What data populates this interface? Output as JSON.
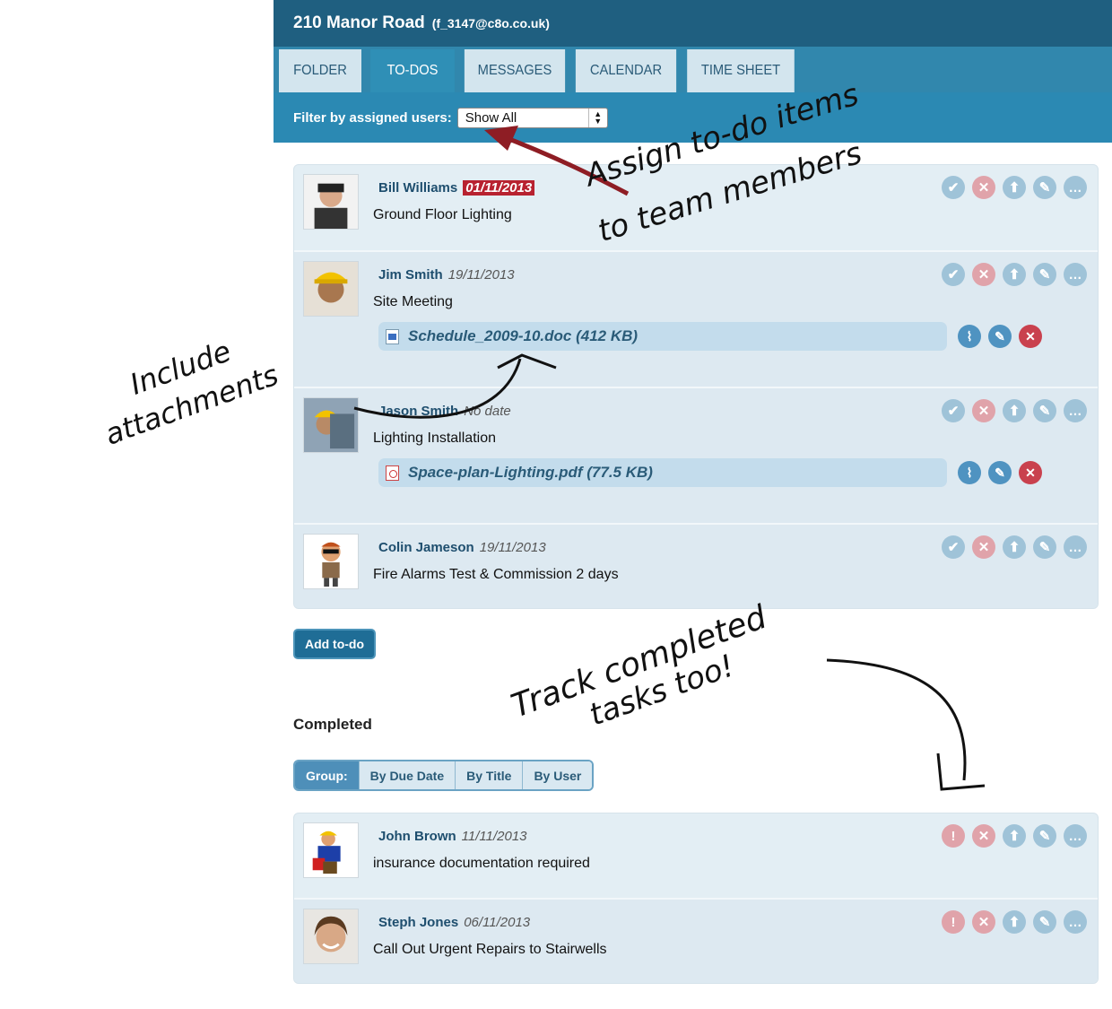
{
  "header": {
    "title": "210 Manor Road",
    "email": "(f_3147@c8o.co.uk)"
  },
  "tabs": [
    {
      "label": "FOLDER"
    },
    {
      "label": "TO-DOS",
      "active": true
    },
    {
      "label": "MESSAGES"
    },
    {
      "label": "CALENDAR"
    },
    {
      "label": "TIME SHEET"
    }
  ],
  "filter": {
    "label": "Filter by assigned users:",
    "selected": "Show All"
  },
  "todos": [
    {
      "user": "Bill Williams",
      "date": "01/11/2013",
      "overdue": true,
      "task": "Ground Floor Lighting"
    },
    {
      "user": "Jim Smith",
      "date": "19/11/2013",
      "task": "Site Meeting",
      "attachment": "Schedule_2009-10.doc (412 KB)"
    },
    {
      "user": "Jason Smith",
      "date": "No date",
      "task": "Lighting Installation",
      "attachment": "Space-plan-Lighting.pdf (77.5 KB)"
    },
    {
      "user": "Colin Jameson",
      "date": "19/11/2013",
      "task": "Fire Alarms Test & Commission 2 days"
    }
  ],
  "add_button": "Add to-do",
  "completed": {
    "heading": "Completed",
    "group": {
      "label": "Group:",
      "options": [
        "By Due Date",
        "By Title",
        "By User"
      ]
    },
    "items": [
      {
        "user": "John Brown",
        "date": "11/11/2013",
        "task": "insurance documentation required"
      },
      {
        "user": "Steph Jones",
        "date": "06/11/2013",
        "task": "Call Out Urgent Repairs to Stairwells"
      }
    ]
  },
  "annotations": {
    "assign_line1": "Assign to-do items",
    "assign_line2": "to team members",
    "include_line1": "Include",
    "include_line2": "attachments",
    "track_line1": "Track completed",
    "track_line2": "tasks too!"
  },
  "icons": {
    "row_actions": [
      "check-icon",
      "close-icon",
      "upload-icon",
      "edit-icon",
      "comment-icon"
    ],
    "completed_row_actions": [
      "exclamation-icon",
      "close-icon",
      "upload-icon",
      "edit-icon",
      "comment-icon"
    ],
    "attachment_actions": [
      "paperclip-icon",
      "edit-icon",
      "delete-icon"
    ]
  },
  "colors": {
    "header": "#1f5f80",
    "tabbar": "#3187ad",
    "overdue": "#b82230",
    "panel": "#e3eef4"
  }
}
